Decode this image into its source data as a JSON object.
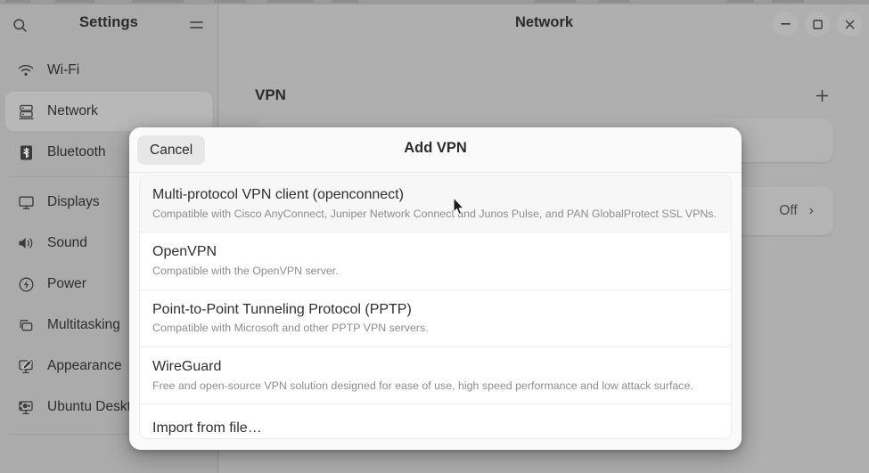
{
  "window": {
    "title": "Network",
    "controls": [
      {
        "name": "minimize",
        "glyph": "–"
      },
      {
        "name": "maximize",
        "glyph": "☐"
      },
      {
        "name": "close",
        "glyph": "✕"
      }
    ]
  },
  "sidebar": {
    "title": "Settings",
    "search_icon": "search-icon",
    "menu_icon": "hamburger-menu-icon",
    "items": [
      {
        "label": "Wi-Fi",
        "icon": "wifi-icon",
        "selected": false
      },
      {
        "label": "Network",
        "icon": "network-icon",
        "selected": true
      },
      {
        "label": "Bluetooth",
        "icon": "bluetooth-icon",
        "selected": false
      },
      {
        "label": "Displays",
        "icon": "display-icon",
        "selected": false
      },
      {
        "label": "Sound",
        "icon": "sound-icon",
        "selected": false
      },
      {
        "label": "Power",
        "icon": "power-icon",
        "selected": false
      },
      {
        "label": "Multitasking",
        "icon": "multitasking-icon",
        "selected": false
      },
      {
        "label": "Appearance",
        "icon": "appearance-icon",
        "selected": false
      },
      {
        "label": "Ubuntu Desktop",
        "icon": "ubuntu-desktop-icon",
        "selected": false
      }
    ]
  },
  "main": {
    "vpn_section_title": "VPN",
    "add_icon": "plus-icon",
    "row_value": "Off",
    "row_chevron": "›"
  },
  "dialog": {
    "title": "Add VPN",
    "cancel_label": "Cancel",
    "items": [
      {
        "name": "Multi-protocol VPN client (openconnect)",
        "desc": "Compatible with Cisco AnyConnect, Juniper Network Connect and Junos Pulse, and PAN GlobalProtect SSL VPNs.",
        "hovered": true
      },
      {
        "name": "OpenVPN",
        "desc": "Compatible with the OpenVPN server.",
        "hovered": false
      },
      {
        "name": "Point-to-Point Tunneling Protocol (PPTP)",
        "desc": "Compatible with Microsoft and other PPTP VPN servers.",
        "hovered": false
      },
      {
        "name": "WireGuard",
        "desc": "Free and open-source VPN solution designed for ease of use, high speed performance and low attack surface.",
        "hovered": false
      },
      {
        "name": "Import from file…",
        "desc": "",
        "hovered": false
      }
    ]
  },
  "colors": {
    "window_bg": "#ababab",
    "sidebar_selected": "#b8b8b8",
    "dialog_bg": "#fafafa",
    "list_bg": "#ffffff",
    "text_primary": "#2e2e2e",
    "text_secondary": "#8d8d8d"
  }
}
